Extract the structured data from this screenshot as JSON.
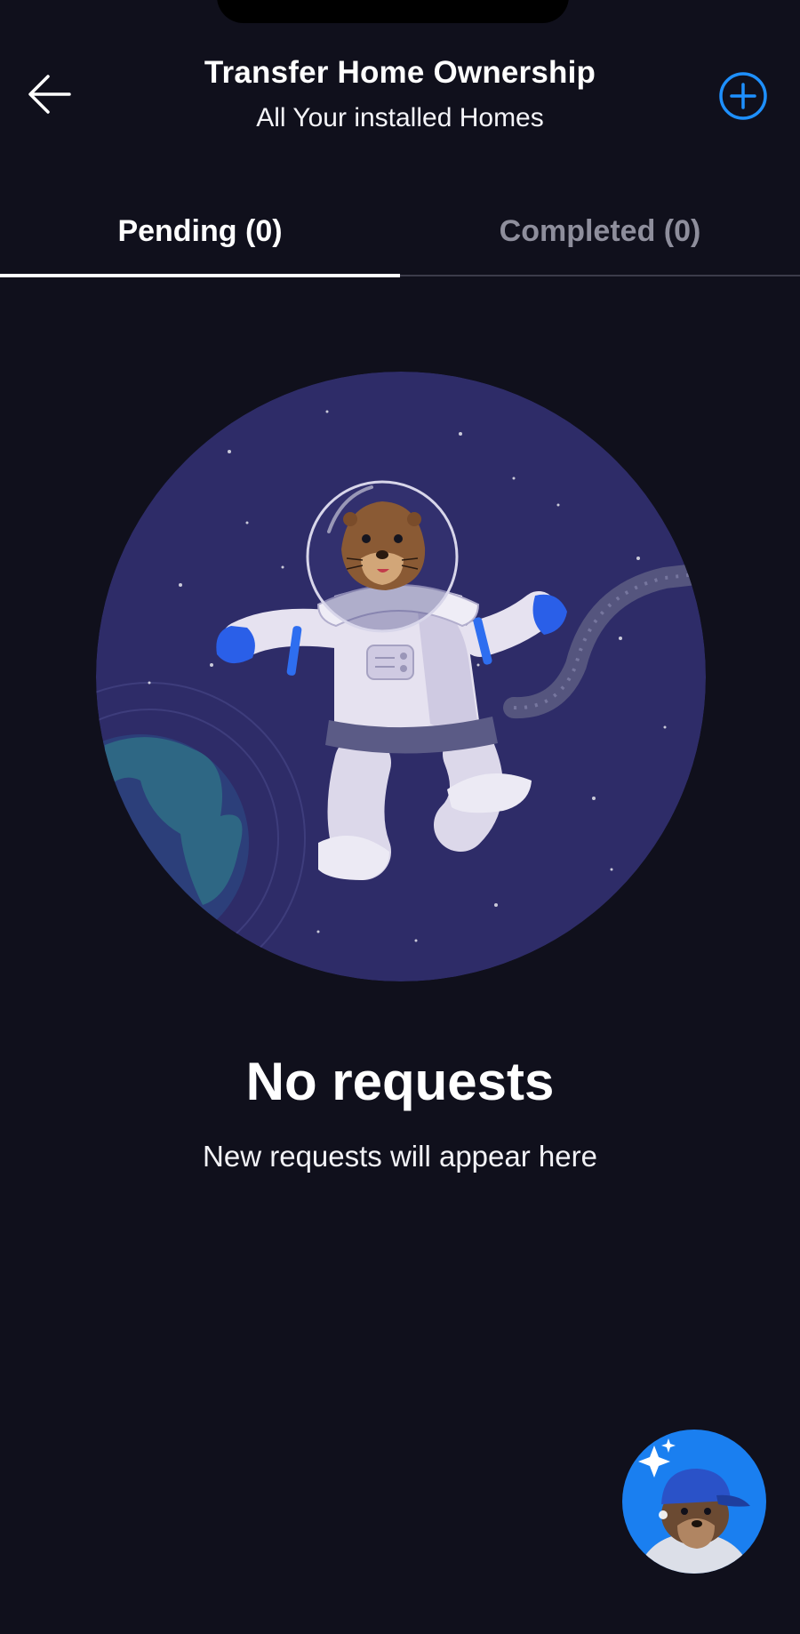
{
  "header": {
    "title": "Transfer Home Ownership",
    "subtitle": "All Your installed Homes",
    "back_icon": "arrow-left-icon",
    "add_icon": "plus-circle-icon"
  },
  "tabs": [
    {
      "label": "Pending (0)",
      "selected": true
    },
    {
      "label": "Completed (0)",
      "selected": false
    }
  ],
  "empty_state": {
    "illustration": "astronaut-otter-in-space",
    "title": "No requests",
    "subtitle": "New requests will appear here"
  },
  "assistant": {
    "icon": "otter-assistant-avatar"
  },
  "colors": {
    "background": "#10101c",
    "accent": "#1e90ff",
    "tab_inactive": "#8e8e9c",
    "space": "#2e2c68"
  }
}
